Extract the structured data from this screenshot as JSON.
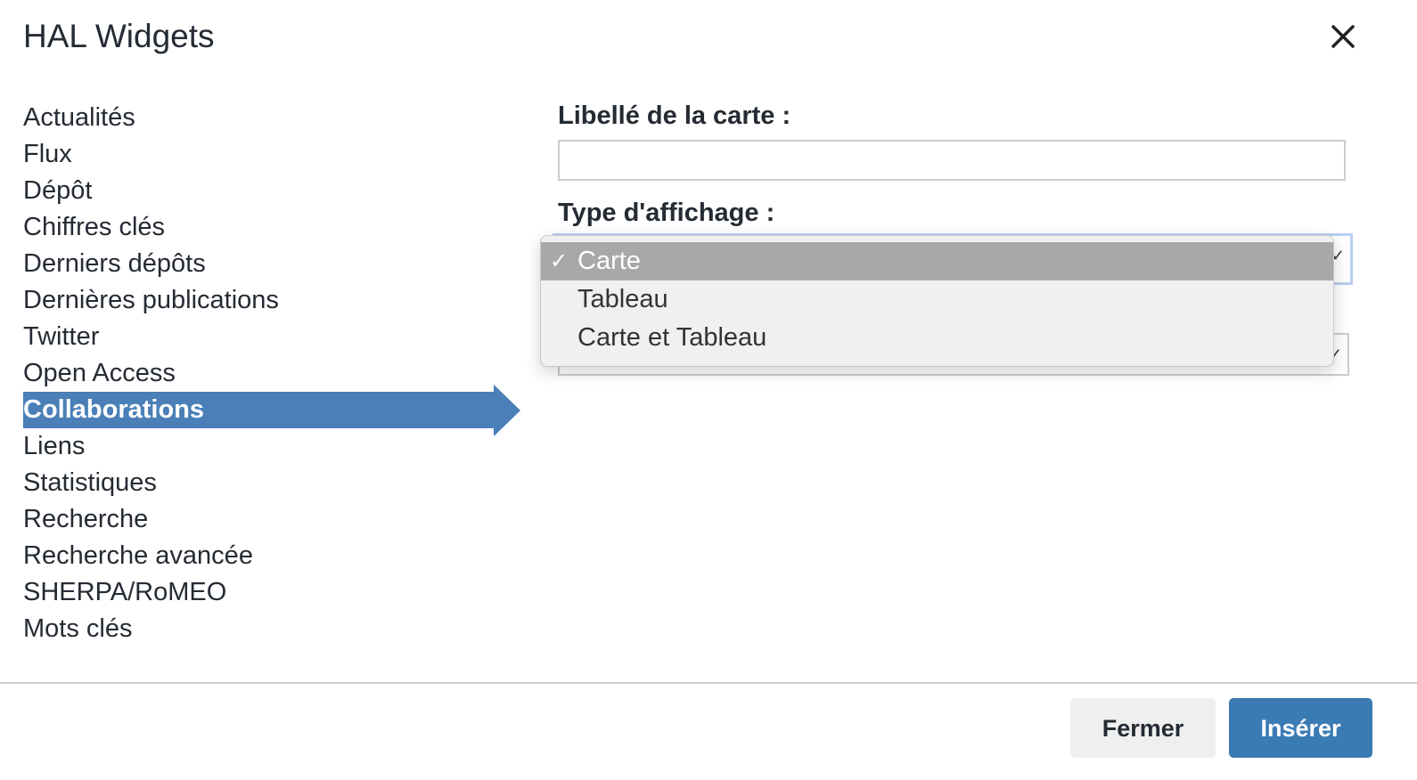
{
  "dialog": {
    "title": "HAL Widgets",
    "close_icon": "close-icon"
  },
  "sidebar": {
    "items": [
      {
        "label": "Actualités"
      },
      {
        "label": "Flux"
      },
      {
        "label": "Dépôt"
      },
      {
        "label": "Chiffres clés"
      },
      {
        "label": "Derniers dépôts"
      },
      {
        "label": "Dernières publications"
      },
      {
        "label": "Twitter"
      },
      {
        "label": "Open Access"
      },
      {
        "label": "Collaborations",
        "active": true
      },
      {
        "label": "Liens"
      },
      {
        "label": "Statistiques"
      },
      {
        "label": "Recherche"
      },
      {
        "label": "Recherche avancée"
      },
      {
        "label": "SHERPA/RoMEO"
      },
      {
        "label": "Mots clés"
      }
    ],
    "active_color": "#4a7fb8"
  },
  "form": {
    "card_label": {
      "label": "Libellé de la carte :",
      "value": ""
    },
    "display_type": {
      "label": "Type d'affichage :",
      "selected": "Carte",
      "options": [
        "Carte",
        "Tableau",
        "Carte et Tableau"
      ]
    }
  },
  "footer": {
    "close_label": "Fermer",
    "insert_label": "Insérer",
    "insert_color": "#3b7bb4"
  }
}
